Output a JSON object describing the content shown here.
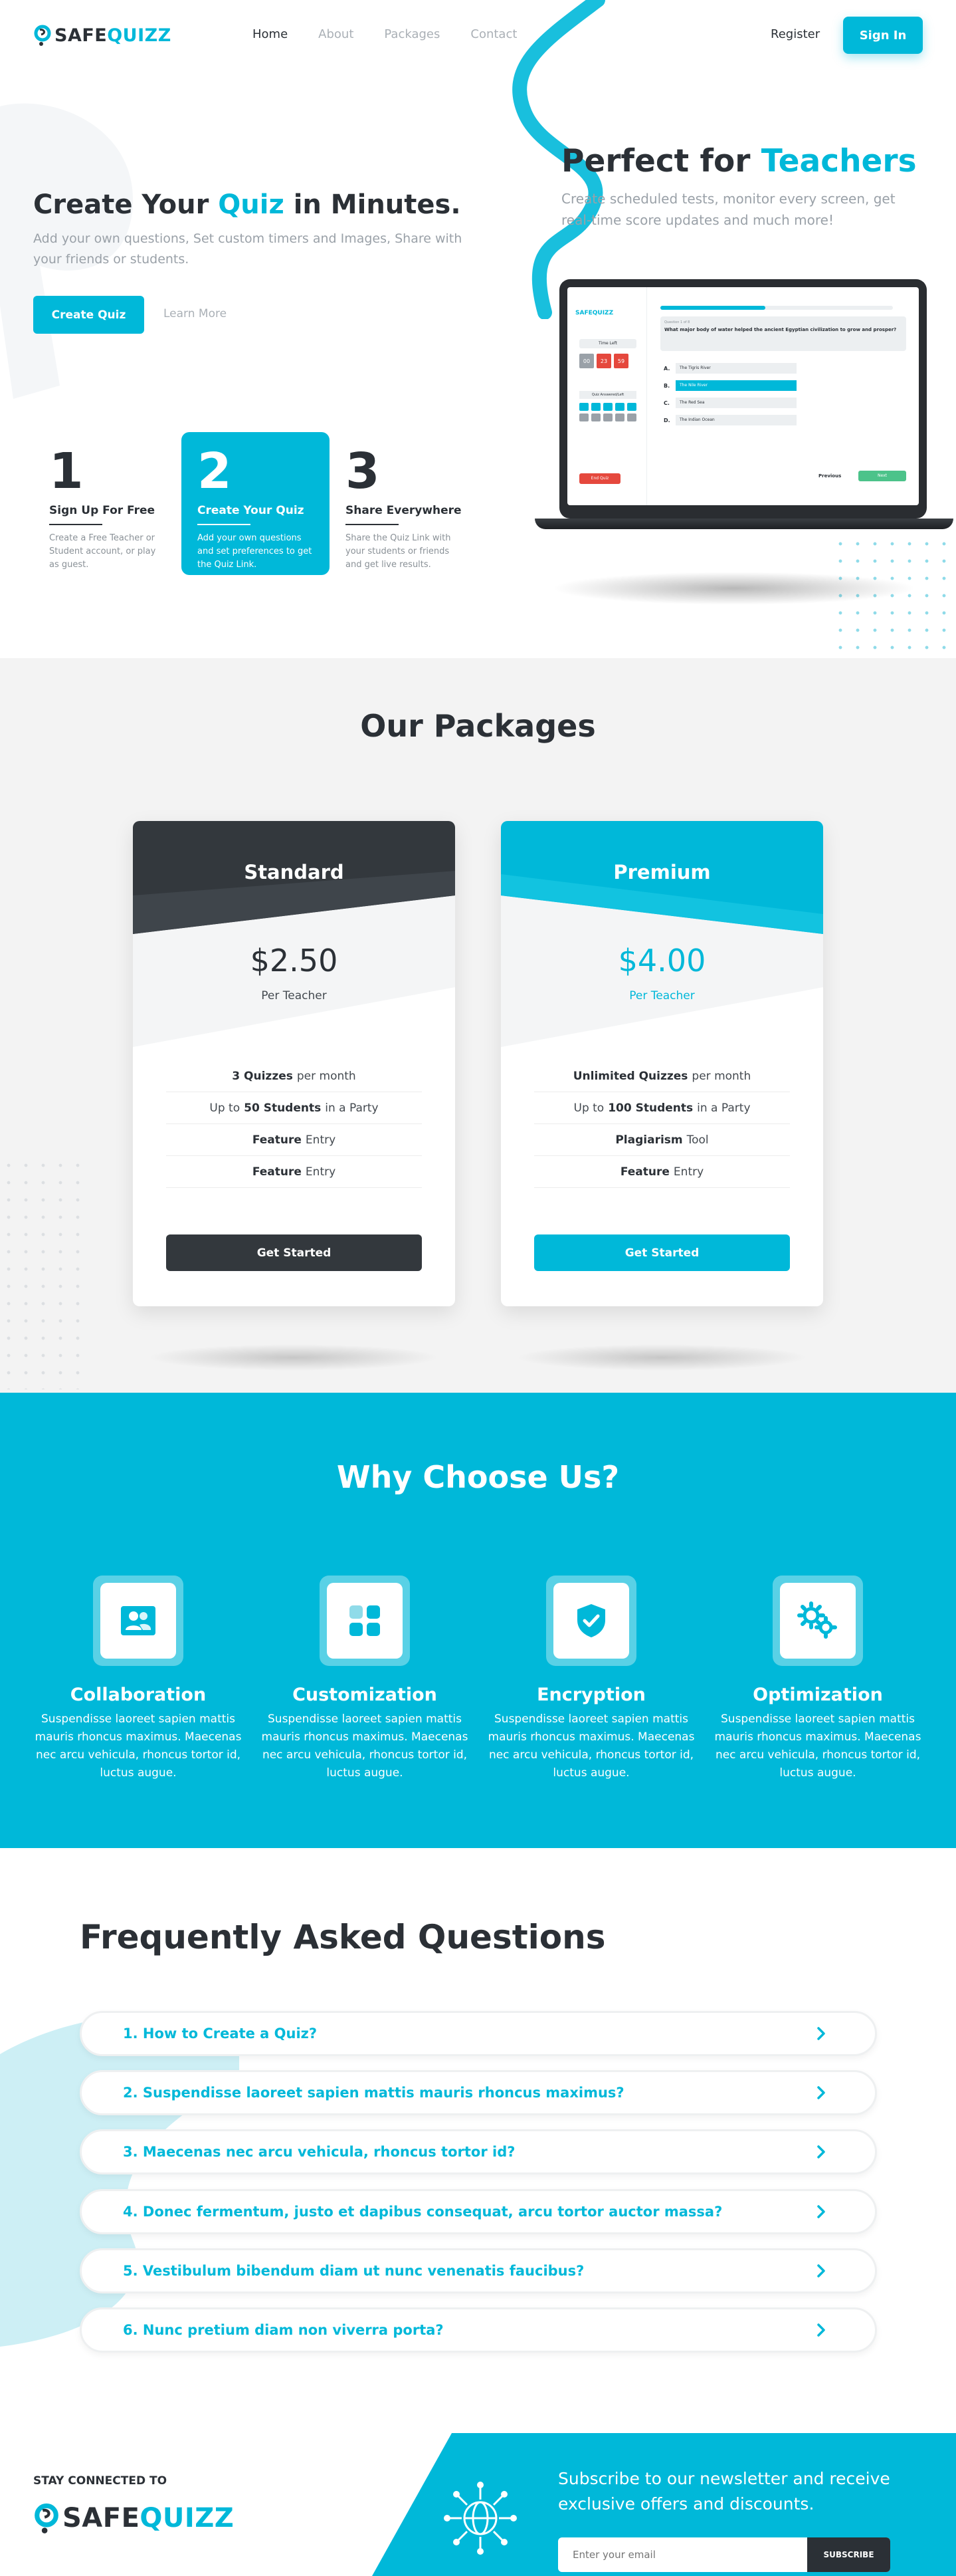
{
  "brand": {
    "part1": "SAFE",
    "part2": "QUIZZ",
    "accent": "#00b8d9",
    "dark": "#2b3036"
  },
  "nav": {
    "items": [
      "Home",
      "About",
      "Packages",
      "Contact"
    ],
    "register": "Register",
    "signin": "Sign In"
  },
  "hero": {
    "title_pre": "Create Your ",
    "title_accent": "Quiz",
    "title_post": " in Minutes.",
    "subtitle": "Add your own questions, Set custom timers and Images, Share with your friends or students.",
    "cta": "Create Quiz",
    "learn_more": "Learn More",
    "steps": [
      {
        "num": "1",
        "title": "Sign Up For Free",
        "desc": "Create a Free Teacher or Student account, or play as guest."
      },
      {
        "num": "2",
        "title": "Create Your Quiz",
        "desc": "Add your own questions and set preferences to get the Quiz Link."
      },
      {
        "num": "3",
        "title": "Share Everywhere",
        "desc": "Share the Quiz Link with your students or friends and get live results."
      }
    ]
  },
  "teachers": {
    "title_pre": "Perfect for ",
    "title_accent": "Teachers",
    "subtitle": "Create scheduled tests, monitor every screen, get real-time score updates and much more!"
  },
  "mock": {
    "logo": "SAFEQUIZZ",
    "time_label": "Time Left",
    "timer": [
      "00",
      "23",
      "59"
    ],
    "answered_label": "Quiz Answered/Left",
    "question_label": "Question 1 of 8",
    "question": "What major body of water helped the ancient Egyptian civilization to grow and prosper?",
    "options": [
      {
        "key": "A.",
        "text": "The Tigris River"
      },
      {
        "key": "B.",
        "text": "The Nile River"
      },
      {
        "key": "C.",
        "text": "The Red Sea"
      },
      {
        "key": "D.",
        "text": "The Indian Ocean"
      }
    ],
    "end": "End Quiz",
    "prev": "Previous",
    "next": "Next"
  },
  "packages": {
    "title": "Our Packages",
    "cards": [
      {
        "name": "Standard",
        "price": "$2.50",
        "per": "Per Teacher",
        "features": [
          [
            "3 Quizzes",
            "per month"
          ],
          [
            "Up to",
            "50 Students",
            "in a Party"
          ],
          [
            "Feature",
            "Entry"
          ],
          [
            "Feature",
            "Entry"
          ]
        ],
        "cta": "Get Started"
      },
      {
        "name": "Premium",
        "price": "$4.00",
        "per": "Per Teacher",
        "features": [
          [
            "Unlimited Quizzes",
            "per month"
          ],
          [
            "Up to",
            "100 Students",
            "in a Party"
          ],
          [
            "Plagiarism",
            "Tool"
          ],
          [
            "Feature",
            "Entry"
          ]
        ],
        "cta": "Get Started"
      }
    ]
  },
  "why": {
    "title": "Why Choose Us?",
    "features": [
      {
        "icon": "users-icon",
        "title": "Collaboration",
        "desc": "Suspendisse laoreet sapien mattis mauris rhoncus maximus. Maecenas nec arcu vehicula, rhoncus tortor id, luctus augue."
      },
      {
        "icon": "grid-icon",
        "title": "Customization",
        "desc": "Suspendisse laoreet sapien mattis mauris rhoncus maximus. Maecenas nec arcu vehicula, rhoncus tortor id, luctus augue."
      },
      {
        "icon": "shield-check-icon",
        "title": "Encryption",
        "desc": "Suspendisse laoreet sapien mattis mauris rhoncus maximus. Maecenas nec arcu vehicula, rhoncus tortor id, luctus augue."
      },
      {
        "icon": "gears-icon",
        "title": "Optimization",
        "desc": "Suspendisse laoreet sapien mattis mauris rhoncus maximus. Maecenas nec arcu vehicula, rhoncus tortor id, luctus augue."
      }
    ]
  },
  "faq": {
    "title": "Frequently Asked Questions",
    "items": [
      "1. How to Create a Quiz?",
      "2. Suspendisse laoreet sapien mattis mauris rhoncus maximus?",
      "3. Maecenas nec arcu vehicula, rhoncus tortor id?",
      "4. Donec fermentum, justo et dapibus consequat, arcu tortor auctor massa?",
      "5. Vestibulum bibendum diam ut nunc venenatis faucibus?",
      "6. Nunc pretium diam non viverra porta?"
    ]
  },
  "footer": {
    "stay": "STAY CONNECTED TO",
    "newsletter": "Subscribe to our newsletter and receive exclusive offers and discounts.",
    "email_placeholder": "Enter your email",
    "subscribe": "SUBSCRIBE"
  }
}
